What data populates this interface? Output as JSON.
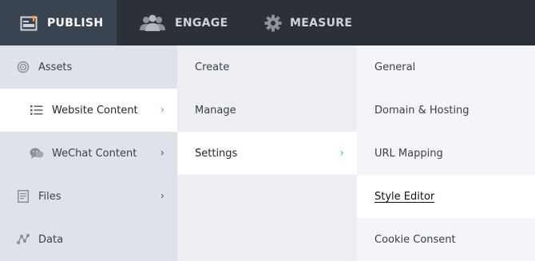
{
  "topnav": {
    "tabs": [
      {
        "label": "PUBLISH",
        "icon": "publish-icon",
        "active": true
      },
      {
        "label": "ENGAGE",
        "icon": "people-icon",
        "active": false
      },
      {
        "label": "MEASURE",
        "icon": "gear-icon",
        "active": false
      }
    ]
  },
  "col1": {
    "items": [
      {
        "label": "Assets",
        "icon": "target-icon"
      },
      {
        "label": "Website Content",
        "icon": "list-icon"
      },
      {
        "label": "WeChat Content",
        "icon": "chat-bubble-icon"
      },
      {
        "label": "Files",
        "icon": "document-icon"
      },
      {
        "label": "Data",
        "icon": "graph-nodes-icon"
      }
    ]
  },
  "col2": {
    "items": [
      {
        "label": "Create"
      },
      {
        "label": "Manage"
      },
      {
        "label": "Settings"
      }
    ]
  },
  "col3": {
    "items": [
      {
        "label": "General"
      },
      {
        "label": "Domain & Hosting"
      },
      {
        "label": "URL Mapping"
      },
      {
        "label": "Style Editor"
      },
      {
        "label": "Cookie Consent"
      }
    ]
  },
  "colors": {
    "topbar": "#2c3139",
    "active_tab": "#3a4350",
    "accent": "#4fb3a9"
  }
}
